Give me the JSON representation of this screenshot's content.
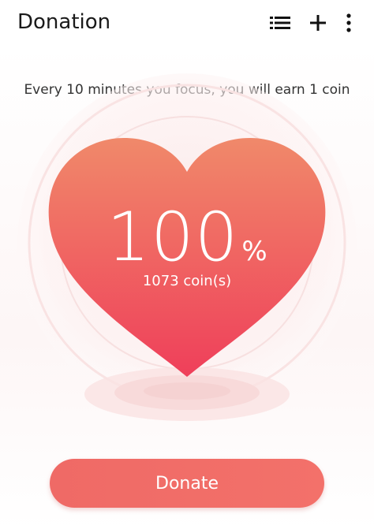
{
  "app_bar": {
    "title": "Donation",
    "actions": [
      {
        "icon": "list-icon"
      },
      {
        "icon": "plus-icon"
      },
      {
        "icon": "more-vertical-icon"
      }
    ]
  },
  "main": {
    "subtitle": "Every 10 minutes you focus, you will earn 1 coin",
    "progress_percent": "100",
    "percent_sign": "%",
    "coins_label": "1073 coin(s)",
    "donate_label": "Donate"
  },
  "colors": {
    "heart_top": "#f0896a",
    "heart_bottom": "#ef3f5a",
    "button": "#f06c67",
    "halo": "#f7d8d8"
  }
}
